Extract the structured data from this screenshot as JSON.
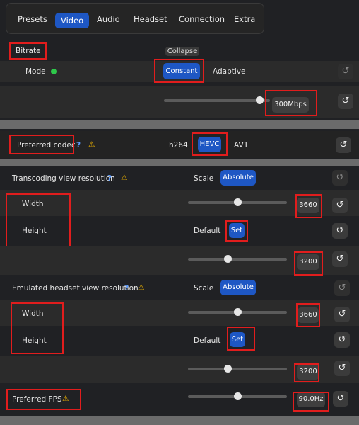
{
  "tabs": [
    {
      "label": "Presets",
      "active": false
    },
    {
      "label": "Video",
      "active": true
    },
    {
      "label": "Audio",
      "active": false
    },
    {
      "label": "Headset",
      "active": false
    },
    {
      "label": "Connection",
      "active": false
    },
    {
      "label": "Extra",
      "active": false
    }
  ],
  "bitrate": {
    "title": "Bitrate",
    "collapse_label": "Collapse",
    "mode_label": "Mode",
    "mode_options": [
      "Constant",
      "Adaptive"
    ],
    "selected_mode": "Constant",
    "slider_value_label": "300Mbps",
    "slider_fraction": 0.9
  },
  "codec": {
    "title": "Preferred codec",
    "help": "?",
    "warning": "⚠",
    "options": [
      "h264",
      "HEVC",
      "AV1"
    ],
    "selected": "HEVC"
  },
  "transcoding": {
    "title": "Transcoding view resolution",
    "help": "?",
    "warning": "⚠",
    "scale_label": "Scale",
    "absolute_label": "Absolute",
    "width_label": "Width",
    "width_value": "3660",
    "width_fraction": 0.5,
    "height_label": "Height",
    "default_label": "Default",
    "set_label": "Set",
    "height_value": "3200",
    "height_fraction": 0.4
  },
  "emulated": {
    "title": "Emulated headset view resolution",
    "help": "?",
    "warning": "⚠",
    "scale_label": "Scale",
    "absolute_label": "Absolute",
    "width_label": "Width",
    "width_value": "3660",
    "width_fraction": 0.5,
    "height_label": "Height",
    "default_label": "Default",
    "set_label": "Set",
    "height_value": "3200",
    "height_fraction": 0.4
  },
  "fps": {
    "title": "Preferred FPS",
    "warning": "⚠",
    "value": "90.0Hz",
    "fraction": 0.5
  },
  "reset_glyph": "↺",
  "colors": {
    "accent": "#1e57c4",
    "highlight_box": "#e11d1d",
    "status_dot": "#2ec84a",
    "warning": "#f0b400"
  }
}
